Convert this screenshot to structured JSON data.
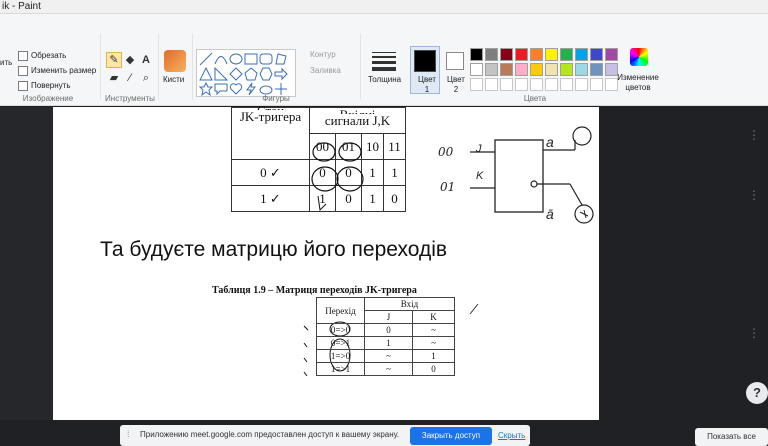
{
  "window": {
    "title": "ik - Paint"
  },
  "ribbon": {
    "image_group": {
      "label": "Изображение",
      "crop": "Обрезать",
      "resize": "Изменить размер",
      "rotate": "Повернуть",
      "select_fragment": "ить"
    },
    "tools_group": {
      "label": "Инструменты"
    },
    "brushes_label": "Кисти",
    "shapes_group": {
      "label": "Фигуры",
      "outline": "Контур",
      "fill": "Заливка"
    },
    "thickness_label": "Толщина",
    "color1_label": "Цвет 1",
    "color2_label": "Цвет 2",
    "colors_group": {
      "label": "Цвета"
    },
    "edit_colors_label": "Изменение цветов",
    "palette_row1": [
      "#000000",
      "#7f7f7f",
      "#880015",
      "#ed1c24",
      "#ff7f27",
      "#fff200",
      "#22b14c",
      "#00a2e8",
      "#3f48cc",
      "#a349a4"
    ],
    "palette_row2": [
      "#ffffff",
      "#c3c3c3",
      "#b97a57",
      "#ffaec9",
      "#ffc90e",
      "#efe4b0",
      "#b5e61d",
      "#99d9ea",
      "#7092be",
      "#c8bfe7"
    ],
    "color1": "#000000",
    "color2": "#ffffff"
  },
  "document": {
    "table1": {
      "header_left_line1": "Стан",
      "header_left_line2": "JK-тригера",
      "header_right_line1": "Вхідні",
      "header_right_line2": "сигнали J,K",
      "inputs": [
        "00",
        "01",
        "10",
        "11"
      ],
      "row1": {
        "state": "0",
        "mark": "✓",
        "values": [
          "0",
          "0",
          "1",
          "1"
        ]
      },
      "row2": {
        "state": "1",
        "mark": "✓",
        "values": [
          "1",
          "0",
          "1",
          "0"
        ]
      }
    },
    "heading": "Та будуєте матрицю його переходів",
    "caption": "Таблиця 1.9 – Матриця переходів JK-тригера",
    "table2": {
      "col_transition": "Перехід",
      "col_input": "Вхід",
      "col_j": "J",
      "col_k": "K",
      "rows": [
        {
          "from": "0",
          "arrow": "=>",
          "to": "0",
          "j": "0",
          "k": "~"
        },
        {
          "from": "0",
          "arrow": "=>",
          "to": "1",
          "j": "1",
          "k": "~"
        },
        {
          "from": "1",
          "arrow": "=>",
          "to": "0",
          "j": "~",
          "k": "1"
        },
        {
          "from": "1",
          "arrow": "=>",
          "to": "1",
          "j": "~",
          "k": "0"
        }
      ]
    },
    "sketch": {
      "in1": "00",
      "j": "J",
      "in2": "01",
      "k": "K",
      "q": "a",
      "nq": "ā"
    }
  },
  "share_bar": {
    "message": "Приложению meet.google.com предоставлен доступ к вашему экрану.",
    "share_button": "Закрыть доступ",
    "hide_link": "Скрыть"
  },
  "show_all_button": "Показать все",
  "help_icon": "?"
}
